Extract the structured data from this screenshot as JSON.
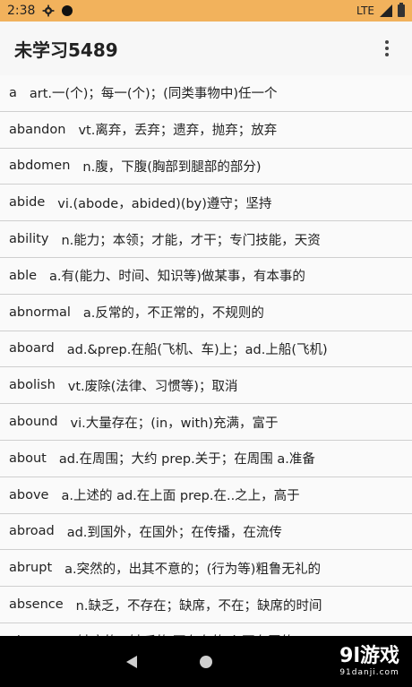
{
  "status": {
    "time": "2:38",
    "network": "LTE"
  },
  "app": {
    "title": "未学习5489"
  },
  "words": [
    {
      "word": "a",
      "def": "art.一(个)；每一(个)；(同类事物中)任一个"
    },
    {
      "word": "abandon",
      "def": "vt.离弃，丢弃；遗弃，抛弃；放弃"
    },
    {
      "word": "abdomen",
      "def": "n.腹，下腹(胸部到腿部的部分)"
    },
    {
      "word": "abide",
      "def": "vi.(abode，abided)(by)遵守；坚持"
    },
    {
      "word": "ability",
      "def": "n.能力；本领；才能，才干；专门技能，天资"
    },
    {
      "word": "able",
      "def": "a.有(能力、时间、知识等)做某事，有本事的"
    },
    {
      "word": "abnormal",
      "def": "a.反常的，不正常的，不规则的"
    },
    {
      "word": "aboard",
      "def": "ad.&prep.在船(飞机、车)上；ad.上船(飞机)"
    },
    {
      "word": "abolish",
      "def": "vt.废除(法律、习惯等)；取消"
    },
    {
      "word": "abound",
      "def": "vi.大量存在；(in，with)充满，富于"
    },
    {
      "word": "about",
      "def": "ad.在周围；大约 prep.关于；在周围 a.准备"
    },
    {
      "word": "above",
      "def": "a.上述的 ad.在上面 prep.在..之上，高于"
    },
    {
      "word": "abroad",
      "def": "ad.到国外，在国外；在传播，在流传"
    },
    {
      "word": "abrupt",
      "def": "a.突然的，出其不意的；(行为等)粗鲁无礼的"
    },
    {
      "word": "absence",
      "def": "n.缺乏，不存在；缺席，不在；缺席的时间"
    },
    {
      "word": "absent",
      "def": "a.缺席的，缺乏的 不存在的 心不在焉的"
    }
  ],
  "watermark": {
    "main": "9l游戏",
    "sub": "91danji.com"
  },
  "icons": {
    "settings": "gear-icon",
    "menu": "more-vert-icon",
    "back": "back-icon",
    "home": "home-icon"
  }
}
